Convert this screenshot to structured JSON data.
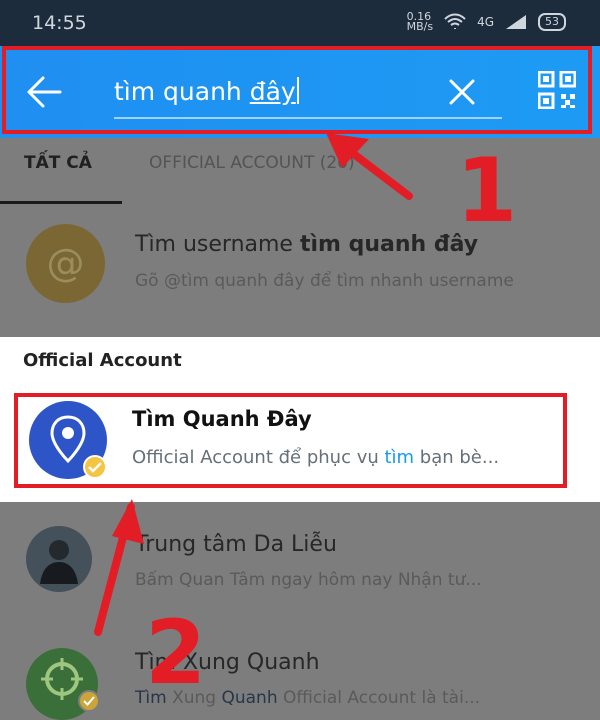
{
  "status": {
    "time": "14:55",
    "network_speed": "0.16\nMB/s",
    "signal": "4G",
    "battery": "53"
  },
  "search": {
    "value_prefix": "tìm quanh ",
    "value_underlined": "đây"
  },
  "tabs": [
    {
      "label": "TẤT CẢ"
    },
    {
      "label": "OFFICIAL ACCOUNT (20)"
    }
  ],
  "username_result": {
    "title_prefix": "Tìm username ",
    "title_bold": "tìm quanh đây",
    "subtitle": "Gõ @tìm quanh đây để tìm nhanh username"
  },
  "official": {
    "section_title": "Official Account",
    "name": "Tìm Quanh Đây",
    "desc_before": "Official Account để phục vụ ",
    "desc_highlight": "tìm",
    "desc_after": " bạn bè..."
  },
  "results": [
    {
      "title": "Trung tâm Da Liễu",
      "subtitle": "Bấm Quan Tâm ngay hôm nay Nhận tư..."
    },
    {
      "title": "Tìm Xung Quanh",
      "subtitle_a": "Tìm",
      "subtitle_b": " Xung ",
      "subtitle_c": "Quanh",
      "subtitle_d": " Official Account là tài..."
    }
  ],
  "annotations": [
    "1",
    "2"
  ],
  "colors": {
    "header": "#1f8ff1",
    "highlight": "#e31d25",
    "link": "#159cf0"
  }
}
